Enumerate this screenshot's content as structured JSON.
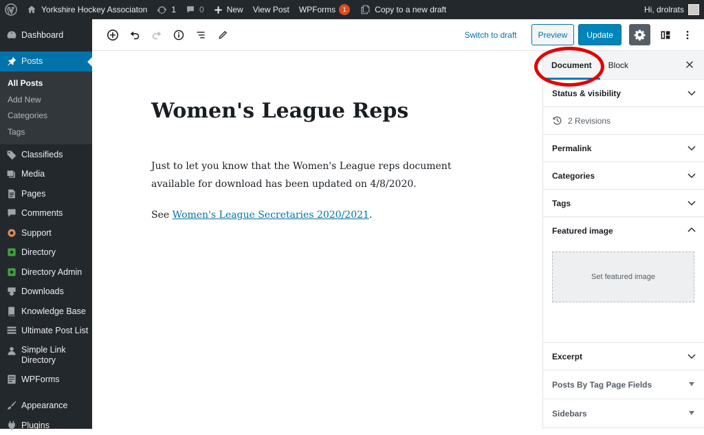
{
  "adminbar": {
    "site_name": "Yorkshire Hockey Associaton",
    "updates_count": "1",
    "comments_count": "0",
    "new_label": "New",
    "view_post_label": "View Post",
    "wpforms_label": "WPForms",
    "wpforms_badge": "1",
    "copy_draft_label": "Copy to a new draft",
    "greeting": "Hi, drolrats"
  },
  "menu": {
    "dashboard": "Dashboard",
    "posts": "Posts",
    "posts_sub": [
      "All Posts",
      "Add New",
      "Categories",
      "Tags"
    ],
    "items": [
      "Classifieds",
      "Media",
      "Pages",
      "Comments",
      "Support",
      "Directory",
      "Directory Admin",
      "Downloads",
      "Knowledge Base",
      "Ultimate Post List"
    ],
    "simple_link_1": "Simple Link",
    "simple_link_2": "Directory",
    "wpforms": "WPForms",
    "appearance": "Appearance",
    "plugins": "Plugins"
  },
  "toolbar": {
    "switch_draft": "Switch to draft",
    "preview": "Preview",
    "update": "Update"
  },
  "post": {
    "title": "Women's League Reps",
    "para1": "Just to let you know that the Women's League reps document available for download has been updated on 4/8/2020.",
    "para2_prefix": "See ",
    "para2_link": "Women's League Secretaries 2020/2021",
    "para2_suffix": "."
  },
  "sidebar": {
    "tab_document": "Document",
    "tab_block": "Block",
    "status_visibility": "Status & visibility",
    "revisions": "2 Revisions",
    "permalink": "Permalink",
    "categories": "Categories",
    "tags": "Tags",
    "featured_image": "Featured image",
    "set_featured": "Set featured image",
    "excerpt": "Excerpt",
    "posts_by_tag": "Posts By Tag Page Fields",
    "sidebars": "Sidebars"
  },
  "colors": {
    "admin_dark": "#23282d",
    "accent_blue": "#0073aa",
    "annotation_red": "#e50000"
  }
}
